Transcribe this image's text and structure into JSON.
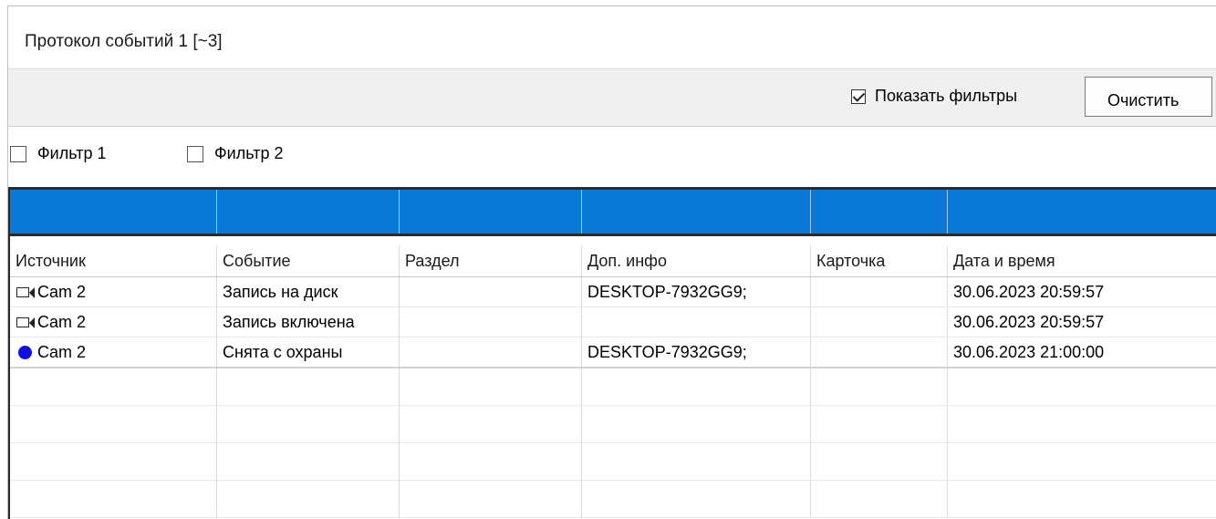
{
  "window": {
    "title": "Протокол событий 1 [~3]"
  },
  "toolbar": {
    "show_filters_label": "Показать фильтры",
    "show_filters_checked": true,
    "clear_label": "Очистить"
  },
  "filters": [
    {
      "label": "Фильтр 1",
      "checked": false
    },
    {
      "label": "Фильтр 2",
      "checked": false
    }
  ],
  "colors": {
    "filter_band": "#0a78d7",
    "status_dot": "#1010e0"
  },
  "table": {
    "columns": [
      "Источник",
      "Событие",
      "Раздел",
      "Доп. инфо",
      "Карточка",
      "Дата и время"
    ],
    "rows": [
      {
        "icon": "camera-icon",
        "source": "Cam 2",
        "event": "Запись на диск",
        "section": "",
        "info": "DESKTOP-7932GG9;",
        "card": "",
        "datetime": "30.06.2023 20:59:57"
      },
      {
        "icon": "camera-icon",
        "source": "Cam 2",
        "event": "Запись включена",
        "section": "",
        "info": "",
        "card": "",
        "datetime": "30.06.2023 20:59:57"
      },
      {
        "icon": "blue-dot-icon",
        "source": "Cam 2",
        "event": "Снята с охраны",
        "section": "",
        "info": "DESKTOP-7932GG9;",
        "card": "",
        "datetime": "30.06.2023 21:00:00"
      }
    ]
  }
}
